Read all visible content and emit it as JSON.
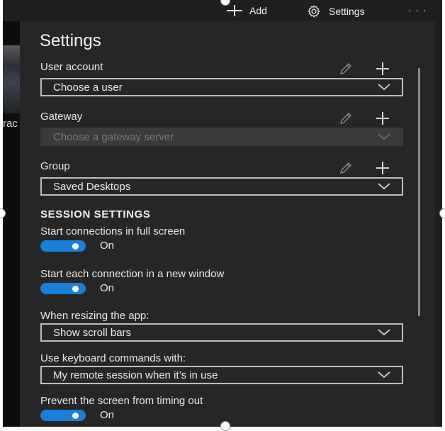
{
  "topbar": {
    "add_label": "Add",
    "settings_label": "Settings",
    "more_label": "· · ·"
  },
  "left_strip": {
    "partial_text": "rac"
  },
  "title": "Settings",
  "user_account": {
    "label": "User account",
    "value": "Choose a user"
  },
  "gateway": {
    "label": "Gateway",
    "placeholder": "Choose a gateway server"
  },
  "group": {
    "label": "Group",
    "value": "Saved Desktops"
  },
  "session_settings": {
    "heading": "SESSION SETTINGS",
    "full_screen": {
      "label": "Start connections in full screen",
      "state": "On",
      "on": true
    },
    "new_window": {
      "label": "Start each connection in a new window",
      "state": "On",
      "on": true
    },
    "resizing": {
      "label": "When resizing the app:",
      "value": "Show scroll bars"
    },
    "keyboard": {
      "label": "Use keyboard commands with:",
      "value": "My remote session when it’s in use"
    },
    "timeout": {
      "label": "Prevent the screen from timing out",
      "state": "On",
      "on": true
    }
  },
  "colors": {
    "accent": "#1a7fd8",
    "panel": "#262626",
    "frame": "#1f1f1f"
  }
}
